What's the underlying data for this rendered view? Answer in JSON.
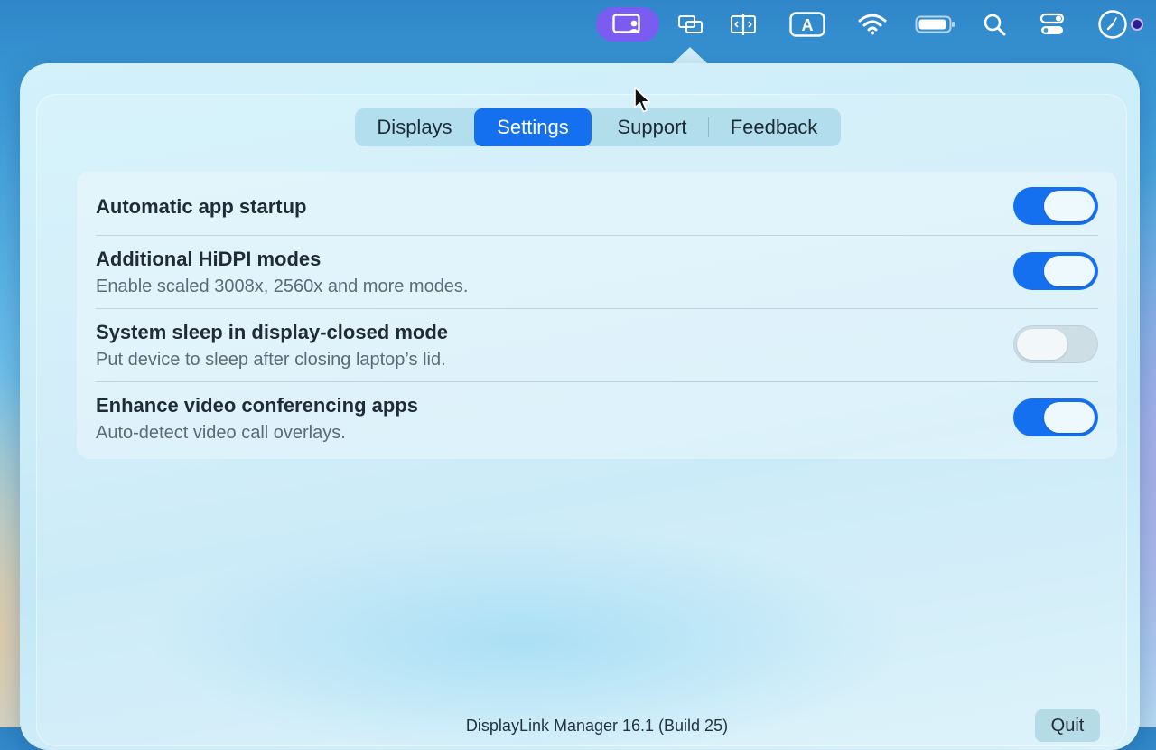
{
  "menubar": {
    "icons": [
      "displaylink-manager-icon",
      "screen-mirroring-icon",
      "split-view-icon",
      "input-source-icon",
      "wifi-icon",
      "battery-icon",
      "spotlight-search-icon",
      "control-center-icon",
      "clock-icon",
      "siri-icon"
    ],
    "input_source_letter": "A"
  },
  "popover": {
    "tabs": [
      {
        "label": "Displays",
        "active": false
      },
      {
        "label": "Settings",
        "active": true
      },
      {
        "label": "Support",
        "active": false
      },
      {
        "label": "Feedback",
        "active": false
      }
    ],
    "settings": [
      {
        "title": "Automatic app startup",
        "description": "",
        "enabled": true
      },
      {
        "title": "Additional HiDPI modes",
        "description": "Enable scaled 3008x, 2560x and more modes.",
        "enabled": true
      },
      {
        "title": "System sleep in display-closed mode",
        "description": "Put device to sleep after closing laptop’s lid.",
        "enabled": false
      },
      {
        "title": "Enhance video conferencing apps",
        "description": "Auto-detect video call overlays.",
        "enabled": true
      }
    ],
    "version_text": "DisplayLink Manager 16.1 (Build 25)",
    "quit_label": "Quit"
  },
  "colors": {
    "accent": "#1570f0",
    "menubar_active": "#7a5cf0"
  }
}
